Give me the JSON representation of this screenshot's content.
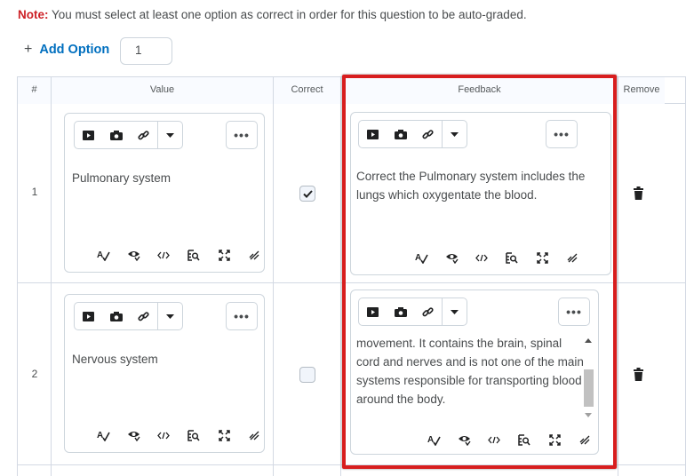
{
  "note": {
    "label": "Note:",
    "text": "You must select at least one option as correct in order for this question to be auto-graded."
  },
  "add_option": {
    "plus": "+",
    "label": "Add Option",
    "count": "1"
  },
  "table": {
    "headers": {
      "num": "#",
      "value": "Value",
      "correct": "Correct",
      "feedback": "Feedback",
      "remove": "Remove"
    },
    "rows": [
      {
        "num": "1",
        "value": "Pulmonary system",
        "correct": true,
        "feedback": "Correct the Pulmonary system includes the lungs which oxygentate the blood."
      },
      {
        "num": "2",
        "value": "Nervous system",
        "correct": false,
        "feedback": "movement. It contains the brain, spinal cord and nerves and is not one of the main systems responsible for transporting blood around the body."
      }
    ]
  },
  "editor_toolbar": {
    "more_label": "•••",
    "icons": [
      "video-icon",
      "camera-icon",
      "link-icon",
      "dropdown-caret-icon"
    ],
    "bottom_icons": [
      "spellcheck-icon",
      "accessibility-checker-icon",
      "source-code-icon",
      "preview-icon",
      "fullscreen-icon",
      "resize-handle-icon"
    ]
  },
  "colors": {
    "note_label": "#cd2026",
    "link": "#006fbf",
    "highlight": "#d81e1e",
    "border": "#cdd5dc"
  }
}
